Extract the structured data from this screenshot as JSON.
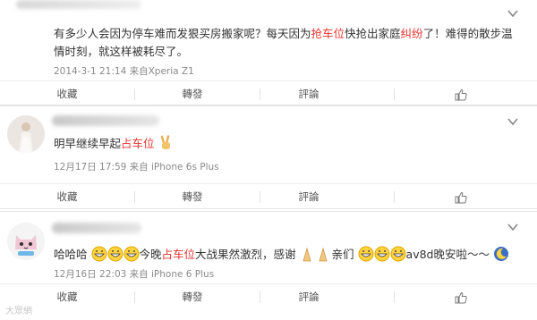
{
  "posts": [
    {
      "text_parts": [
        "有多少人会因为停车难而发狠买房搬家呢？每天因为",
        "抢车位",
        "快抢出家庭",
        "纠纷",
        "了！难得的散步温情时刻，就这样被耗尽了。"
      ],
      "meta": "2014-3-1 21:14 来自Xperia Z1",
      "actions": {
        "collect": "收藏",
        "forward": "轉發",
        "comment": "評論"
      }
    },
    {
      "text_parts": [
        "明早继续早起",
        "占车位"
      ],
      "meta": "12月17日 17:59 来自 iPhone 6s Plus",
      "actions": {
        "collect": "收藏",
        "forward": "轉發",
        "comment": "評論"
      }
    },
    {
      "text_parts": [
        "哈哈哈",
        "今晚",
        "占车位",
        "大战果然激烈，感谢",
        "亲们",
        "av8d晚安啦～～"
      ],
      "meta": "12月16日 22:03 来自 iPhone 6 Plus",
      "actions": {
        "collect": "收藏",
        "forward": "轉發",
        "comment": "評論"
      }
    }
  ],
  "watermark": "大眾網",
  "colors": {
    "highlight": "#e8322d",
    "meta": "#8a8a8a",
    "border": "#e4e4e4"
  },
  "icons": [
    "chevron-down-icon",
    "like-icon",
    "victory-hand-emoji",
    "grin-emoji",
    "praying-hands-emoji",
    "sleeping-moon-emoji"
  ]
}
